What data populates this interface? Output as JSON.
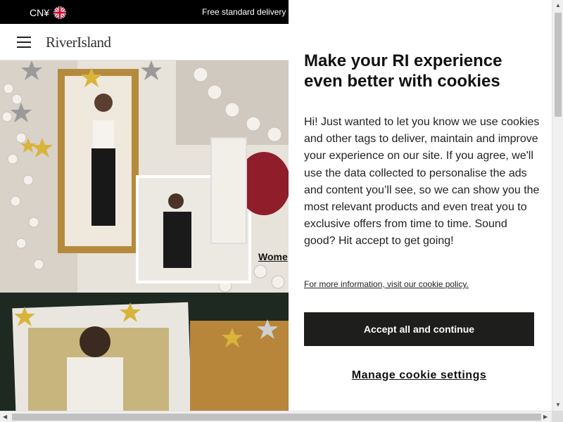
{
  "topbar": {
    "currency": "CN¥",
    "flag_icon": "uk-flag-icon",
    "promo": "Free standard delivery"
  },
  "header": {
    "menu_icon": "hamburger-menu-icon",
    "logo": "RiverIsland"
  },
  "hero": {
    "label": "Wome"
  },
  "cookie": {
    "title": "Make your RI experience even better with cookies",
    "body": "Hi! Just wanted to let you know we use cookies and other tags to deliver, maintain and improve your experience on our site. If you agree, we'll use the data collected to personalise the ads and content you’ll see, so we can show you the most relevant products and even treat you to exclusive offers from time to time. Sound good? Hit accept to get going!",
    "link": "For more information, visit our cookie policy.",
    "accept_label": "Accept all and continue",
    "manage_label": "Manage cookie settings"
  },
  "colors": {
    "topbar_bg": "#000000",
    "accept_bg": "#1e1e1c",
    "hero_green": "#1f2a22"
  }
}
